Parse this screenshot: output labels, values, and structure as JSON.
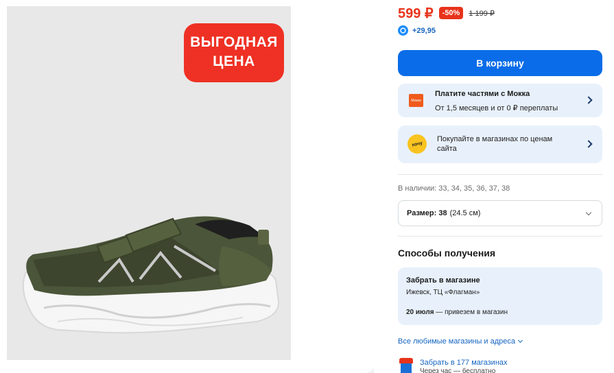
{
  "product": {
    "badge_line1": "ВЫГОДНАЯ",
    "badge_line2": "ЦЕНА"
  },
  "pricing": {
    "price": "599 ₽",
    "discount": "-50%",
    "old_price": "1 199 ₽",
    "bonus": "+29,95"
  },
  "cart": {
    "button_label": "В корзину"
  },
  "mokka": {
    "logo_text": "Мокка",
    "title": "Платите частями с Мокка",
    "subtitle": "От 1,5 месяцев и от 0 ₽ переплаты"
  },
  "hochu": {
    "logo_text": "хочу",
    "text": "Покупайте в магазинах по ценам сайта"
  },
  "sizes": {
    "available": "В наличии: 33, 34, 35, 36, 37, 38",
    "selected_label": "Размер: 38",
    "selected_detail": "(24.5 см)"
  },
  "delivery": {
    "section_title": "Способы получения",
    "pickup_title": "Забрать в магазине",
    "pickup_address": "Ижевск, ТЦ «Флагман»",
    "pickup_date": "20 июля",
    "pickup_date_note": " — привезем в магазин",
    "all_stores_link": "Все любимые магазины и адреса",
    "stores_pickup": "Забрать в 177 магазинах",
    "stores_pickup_sub": "Через час — бесплатно"
  },
  "colors": {
    "accent_blue": "#0a6ce8",
    "sale_red": "#e8331b",
    "card_bg": "#e8f1fb"
  }
}
